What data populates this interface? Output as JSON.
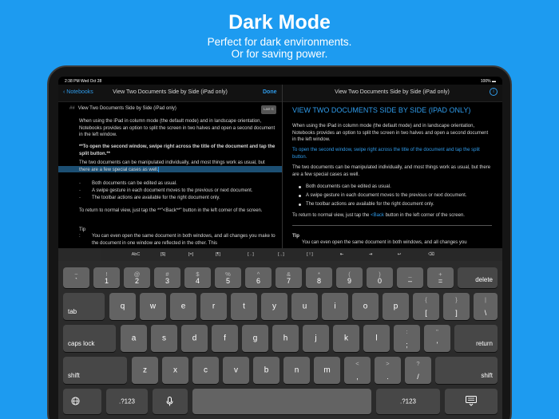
{
  "hero": {
    "title": "Dark Mode",
    "subtitle_1": "Perfect for dark environments.",
    "subtitle_2": "Or for saving power."
  },
  "status": {
    "time": "2:38 PM   Wed Oct 28",
    "battery": "100% ▬"
  },
  "nav": {
    "back_label": "Notebooks",
    "title_left": "View Two Documents Side by Side (iPad only)",
    "done_label": "Done",
    "title_right": "View Two Documents Side by Side (iPad only)",
    "info_icon": "i"
  },
  "editor": {
    "heading_hash": "##",
    "heading": "View Two Documents Side by Side (iPad only)",
    "badge": "Last C",
    "p1": "When using the iPad in column mode (the default mode) and in landscape orientation, Notebooks provides an option to split the screen in two halves and open a second document in the left window.",
    "p2": "**To open the second window, swipe right across the title of the document and tap the split button.**",
    "p3_a": "The two documents can be manipulated individually, and most things work as usual, but there are a few special cases as well.",
    "bullets": [
      "Both documents can be edited as usual.",
      "A swipe gesture in each document moves to the previous or next document.",
      "The toolbar actions are available for the right document only."
    ],
    "p4": "To return to normal view, just tap the **\"<Back**\" button in the left corner of the screen.",
    "tip_label": "Tip",
    "tip_colon": ":",
    "tip_text": "You can even open the same document in both windows, and all changes you make to the document in one window are reflected in the other. This"
  },
  "preview": {
    "heading": "VIEW TWO DOCUMENTS SIDE BY SIDE (IPAD ONLY)",
    "p1": "When using the iPad in column mode (the default mode) and in landscape orientation, Notebooks provides an option to split the screen in two halves and open a second document in the left window.",
    "p2": "To open the second window, swipe right across the title of the document and tap the split button.",
    "p3": "The two documents can be manipulated individually, and most things work as usual, but there are a few special cases as well.",
    "bullets": [
      "Both documents can be edited as usual.",
      "A swipe gesture in each document moves to the previous or next document.",
      "The toolbar actions are available for the right document only."
    ],
    "p4_a": "To return to normal view, just tap the ",
    "p4_link": "<Back",
    "p4_b": " button in the left corner of the screen.",
    "tip_label": "Tip",
    "tip_text": "You can even open the same document in both windows, and all changes you"
  },
  "toolbar": {
    "items": [
      "AbC",
      "[$]",
      "[=]",
      "[¶]",
      "[ . ]",
      "[ , ]",
      "[ ! ]",
      "⇤",
      "⇥",
      "↩",
      "⌫"
    ]
  },
  "keyboard": {
    "row1": [
      {
        "top": "~",
        "bot": "`"
      },
      {
        "top": "!",
        "bot": "1"
      },
      {
        "top": "@",
        "bot": "2"
      },
      {
        "top": "#",
        "bot": "3"
      },
      {
        "top": "$",
        "bot": "4"
      },
      {
        "top": "%",
        "bot": "5"
      },
      {
        "top": "^",
        "bot": "6"
      },
      {
        "top": "&",
        "bot": "7"
      },
      {
        "top": "*",
        "bot": "8"
      },
      {
        "top": "(",
        "bot": "9"
      },
      {
        "top": ")",
        "bot": "0"
      },
      {
        "top": "_",
        "bot": "–"
      },
      {
        "top": "+",
        "bot": "="
      }
    ],
    "delete": "delete",
    "tab": "tab",
    "row2": [
      "q",
      "w",
      "e",
      "r",
      "t",
      "y",
      "u",
      "i",
      "o",
      "p"
    ],
    "row2_extra": [
      {
        "top": "{",
        "bot": "["
      },
      {
        "top": "}",
        "bot": "]"
      },
      {
        "top": "|",
        "bot": "\\"
      }
    ],
    "caps": "caps lock",
    "row3": [
      "a",
      "s",
      "d",
      "f",
      "g",
      "h",
      "j",
      "k",
      "l"
    ],
    "row3_extra": [
      {
        "top": ":",
        "bot": ";"
      },
      {
        "top": "\"",
        "bot": "'"
      }
    ],
    "return": "return",
    "shift": "shift",
    "row4": [
      "z",
      "x",
      "c",
      "v",
      "b",
      "n",
      "m"
    ],
    "row4_extra": [
      {
        "top": "<",
        "bot": ","
      },
      {
        "top": ">",
        "bot": "."
      },
      {
        "top": "?",
        "bot": "/"
      }
    ],
    "globe_icon": "globe",
    "num_label": ".?123",
    "mic_icon": "microphone",
    "dismiss_icon": "keyboard-dismiss"
  }
}
